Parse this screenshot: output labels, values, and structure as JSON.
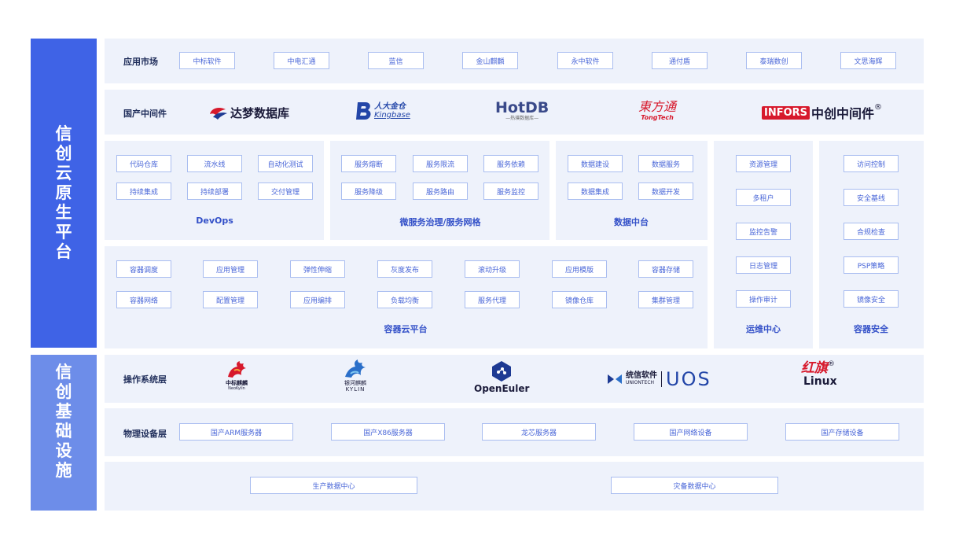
{
  "sidebar": {
    "top_chars": [
      "信",
      "创",
      "云",
      "原",
      "生",
      "平",
      "台"
    ],
    "bottom_chars": [
      "信",
      "创",
      "基",
      "础",
      "设",
      "施"
    ]
  },
  "app_market": {
    "title": "应用市场",
    "items": [
      "中标软件",
      "中电汇通",
      "蓝信",
      "金山麒麟",
      "永中软件",
      "通付盾",
      "泰瑞数创",
      "文思海辉"
    ]
  },
  "middleware": {
    "title": "国产中间件",
    "logos": {
      "dameng": "达梦数据库",
      "kingbase_cn": "人大金仓",
      "kingbase_en": "Kingbase",
      "hotdb": "HotDB",
      "hotdb_sub": "—热璞数据库—",
      "tongtech_cn": "東方通",
      "tongtech_en": "TongTech",
      "infors_box": "INFORS",
      "infors_cn": "中创中间件",
      "infors_mark": "®"
    }
  },
  "devops": {
    "title": "DevOps",
    "items": [
      "代码仓库",
      "流水线",
      "自动化测试",
      "持续集成",
      "持续部署",
      "交付管理"
    ]
  },
  "micro": {
    "title": "微服务治理/服务网格",
    "items": [
      "服务熔断",
      "服务限流",
      "服务依赖",
      "服务降级",
      "服务路由",
      "服务监控"
    ]
  },
  "data_center": {
    "title": "数据中台",
    "items": [
      "数据建设",
      "数据服务",
      "数据集成",
      "数据开发"
    ]
  },
  "ops": {
    "title": "运维中心",
    "items": [
      "资源管理",
      "多租户",
      "监控告警",
      "日志管理",
      "操作审计"
    ]
  },
  "container_security": {
    "title": "容器安全",
    "items": [
      "访问控制",
      "安全基线",
      "合规检查",
      "PSP策略",
      "镜像安全"
    ]
  },
  "container_cloud": {
    "title": "容器云平台",
    "row1": [
      "容器调度",
      "应用管理",
      "弹性伸缩",
      "灰度发布",
      "滚动升级",
      "应用模版",
      "容器存储"
    ],
    "row2": [
      "容器网络",
      "配置管理",
      "应用编排",
      "负载均衡",
      "服务代理",
      "镜像仓库",
      "集群管理"
    ]
  },
  "os": {
    "title": "操作系统层",
    "logos": {
      "neokylin_cn": "中标麒麟",
      "neokylin_en": "NeoKylin",
      "kylin_cn": "银河麒麟",
      "kylin_en": "KYLIN",
      "openeuler": "OpenEuler",
      "uos_cn": "统信软件",
      "uos_en": "UNIONTECH",
      "uos_mark": "UOS",
      "redflag_cn": "红旗",
      "redflag_en": "Linux",
      "redflag_mark": "®"
    }
  },
  "physical": {
    "title": "物理设备层",
    "items": [
      "国产ARM服务器",
      "国产X86服务器",
      "龙芯服务器",
      "国产网络设备",
      "国产存储设备"
    ]
  },
  "datacenter": {
    "items": [
      "生产数据中心",
      "灾备数据中心"
    ]
  },
  "colors": {
    "primary": "#3f63e6",
    "secondary": "#6d8de9",
    "panel": "#eef2fb",
    "tag_border": "#a9bdf0",
    "red": "#d7192c"
  }
}
